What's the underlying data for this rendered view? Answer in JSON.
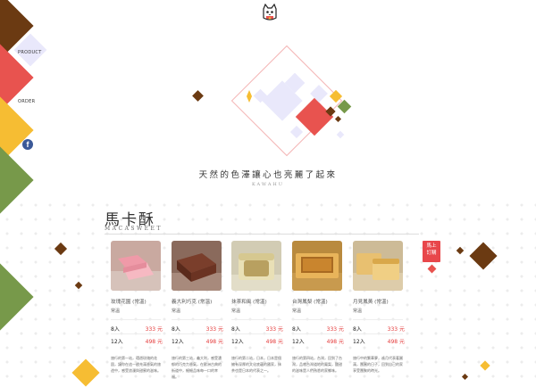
{
  "nav": {
    "items": [
      {
        "label": "PRODUCT"
      },
      {
        "label": "ORDER"
      }
    ],
    "facebook_icon": "f"
  },
  "hero": {
    "tagline": "天然的色澤讓心也亮麗了起來",
    "subtitle": "KAWAHU"
  },
  "section": {
    "title": "馬卡酥",
    "subtitle": "MACASWEET"
  },
  "buy_button": {
    "line1": "馬上",
    "line2": "訂購"
  },
  "colors": {
    "brown": "#6b3a12",
    "red": "#e8534f",
    "yellow": "#f6bd33",
    "green": "#77994a",
    "lavender": "#e9e8fb",
    "price_red": "#e43a3a"
  },
  "products": [
    {
      "name": "玫瑰花園 (常溫)",
      "flavor": "常溫",
      "prices": [
        {
          "qty": "8入",
          "price": "333 元"
        },
        {
          "qty": "12入",
          "price": "498 元"
        }
      ],
      "desc": "旅行的第一站，環遊玫瑰的花園，讓你在這一趟充滿香氣的旅途中，感受浪漫與甜蜜的滋味。"
    },
    {
      "name": "義大利巧克 (常溫)",
      "flavor": "常溫",
      "prices": [
        {
          "qty": "8入",
          "price": "333 元"
        },
        {
          "qty": "12入",
          "price": "498 元"
        }
      ],
      "desc": "旅行的第三站，義大利，感受濃郁的巧克力香氣，在歐洲古典的街道中，細細品味每一口的幸福。"
    },
    {
      "name": "抹茶和風 (常溫)",
      "flavor": "常溫",
      "prices": [
        {
          "qty": "8入",
          "price": "333 元"
        },
        {
          "qty": "12入",
          "price": "498 元"
        }
      ],
      "desc": "旅行的第二站，日本，日本是個擁有深厚的文化底蘊的國家，抹茶也是日本的代表之一。"
    },
    {
      "name": "台灣鳳梨 (常溫)",
      "flavor": "常溫",
      "prices": [
        {
          "qty": "8入",
          "price": "333 元"
        },
        {
          "qty": "12入",
          "price": "498 元"
        }
      ],
      "desc": "旅行的第四站，台灣，回到了台灣，品嚐台灣道地的鳳梨，酸甜的滋味是人們熟悉的家鄉味。"
    },
    {
      "name": "月見鳳黃 (常溫)",
      "flavor": "常溫",
      "prices": [
        {
          "qty": "8入",
          "price": "333 元"
        },
        {
          "qty": "12入",
          "price": "498 元"
        }
      ],
      "desc": "旅行中的繁華夢，遙月代表著圓滿，團圓的日子，回到自己的家享受團聚的時光。"
    }
  ]
}
